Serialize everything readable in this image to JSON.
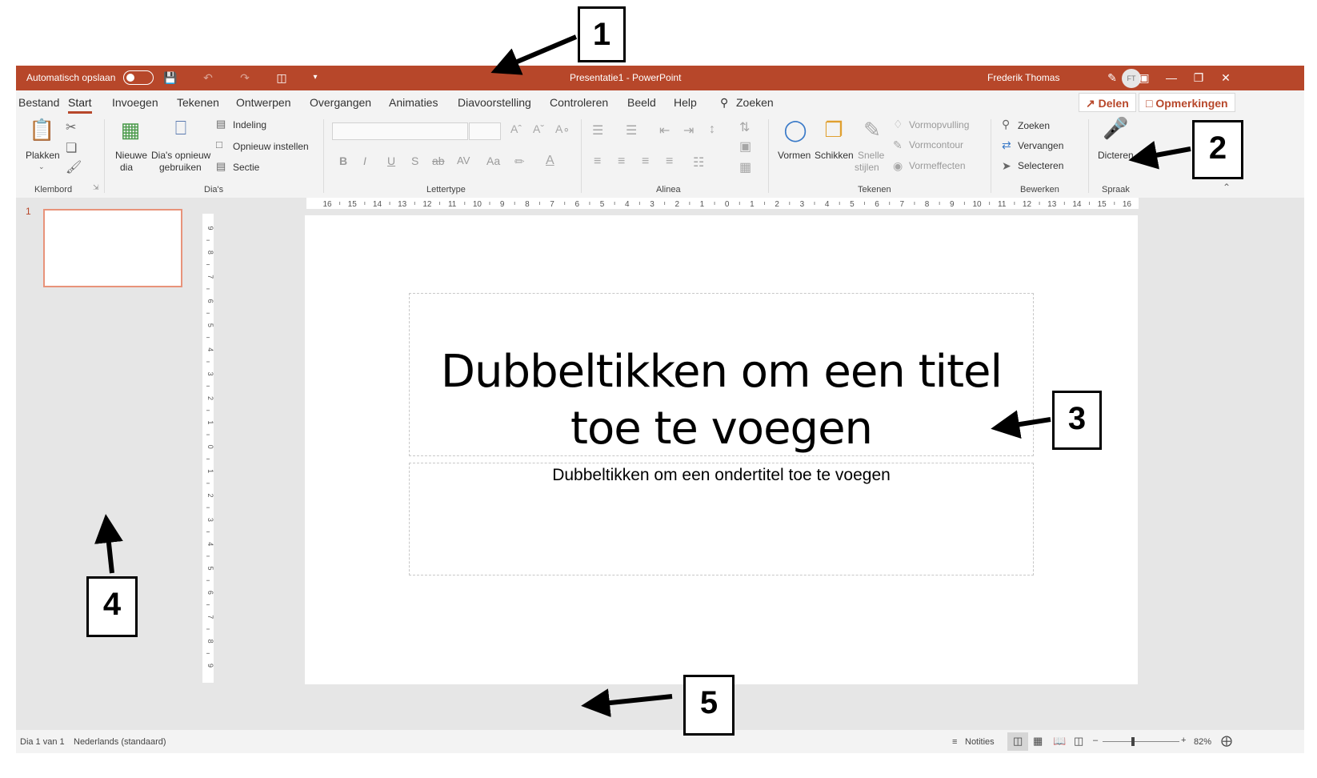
{
  "titlebar": {
    "autosave_label": "Automatisch opslaan",
    "title": "Presentatie1  -  PowerPoint",
    "user_name": "Frederik Thomas",
    "avatar_initials": "FT",
    "accent": "#b7472a"
  },
  "tabs": [
    "Bestand",
    "Start",
    "Invoegen",
    "Tekenen",
    "Ontwerpen",
    "Overgangen",
    "Animaties",
    "Diavoorstelling",
    "Controleren",
    "Beeld",
    "Help"
  ],
  "active_tab": "Start",
  "search_label": "Zoeken",
  "share_label": "Delen",
  "comments_label": "Opmerkingen",
  "ribbon": {
    "clipboard": {
      "paste": "Plakken",
      "group": "Klembord"
    },
    "slides": {
      "new_slide_1": "Nieuwe",
      "new_slide_2": "dia",
      "reuse_1": "Dia's opnieuw",
      "reuse_2": "gebruiken",
      "layout": "Indeling",
      "reset": "Opnieuw instellen",
      "section": "Sectie",
      "group": "Dia's"
    },
    "font": {
      "group": "Lettertype",
      "bold": "B",
      "italic": "I",
      "underline": "U",
      "shadow": "S",
      "strike": "ab",
      "spacing": "AV",
      "case": "Aa"
    },
    "paragraph": {
      "group": "Alinea"
    },
    "drawing": {
      "shapes": "Vormen",
      "arrange": "Schikken",
      "styles_1": "Snelle",
      "styles_2": "stijlen",
      "fill": "Vormopvulling",
      "outline": "Vormcontour",
      "effects": "Vormeffecten",
      "group": "Tekenen"
    },
    "editing": {
      "find": "Zoeken",
      "replace": "Vervangen",
      "select": "Selecteren",
      "group": "Bewerken"
    },
    "voice": {
      "dictate": "Dicteren",
      "group": "Spraak"
    }
  },
  "ruler_h": [
    "16",
    "15",
    "14",
    "13",
    "12",
    "11",
    "10",
    "9",
    "8",
    "7",
    "6",
    "5",
    "4",
    "3",
    "2",
    "1",
    "0",
    "1",
    "2",
    "3",
    "4",
    "5",
    "6",
    "7",
    "8",
    "9",
    "10",
    "11",
    "12",
    "13",
    "14",
    "15",
    "16"
  ],
  "ruler_v": [
    "9",
    "8",
    "7",
    "6",
    "5",
    "4",
    "3",
    "2",
    "1",
    "0",
    "1",
    "2",
    "3",
    "4",
    "5",
    "6",
    "7",
    "8",
    "9"
  ],
  "thumbnails": {
    "slide_number": "1"
  },
  "slide": {
    "title_line1": "Dubbeltikken om een titel",
    "title_line2": "toe te voegen",
    "subtitle": "Dubbeltikken om een ondertitel toe te voegen"
  },
  "status": {
    "slide_info": "Dia 1 van 1",
    "language": "Nederlands (standaard)",
    "notes": "Notities",
    "zoom": "82%"
  },
  "callouts": [
    "1",
    "2",
    "3",
    "4",
    "5"
  ]
}
